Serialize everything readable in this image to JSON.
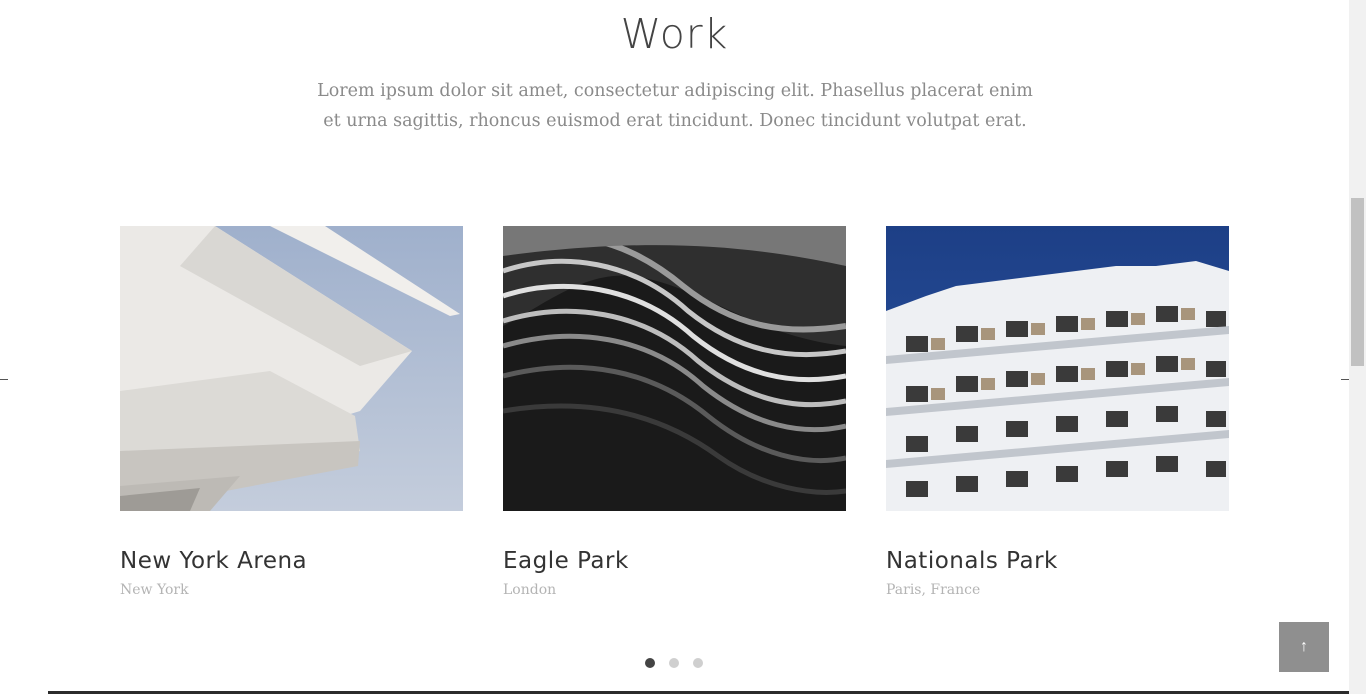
{
  "section": {
    "title": "Work",
    "lead": "Lorem ipsum dolor sit amet, consectetur adipiscing elit. Phasellus placerat enim et urna sagittis, rhoncus euismod erat tincidunt. Donec tincidunt volutpat erat."
  },
  "cards": [
    {
      "name": "New York Arena",
      "place": "New York"
    },
    {
      "name": "Eagle Park",
      "place": "London"
    },
    {
      "name": "Nationals Park",
      "place": "Paris, France"
    }
  ],
  "carousel": {
    "pages": 3,
    "active_page": 1
  },
  "back_to_top": {
    "icon": "arrow-up-icon",
    "glyph": "↑"
  }
}
